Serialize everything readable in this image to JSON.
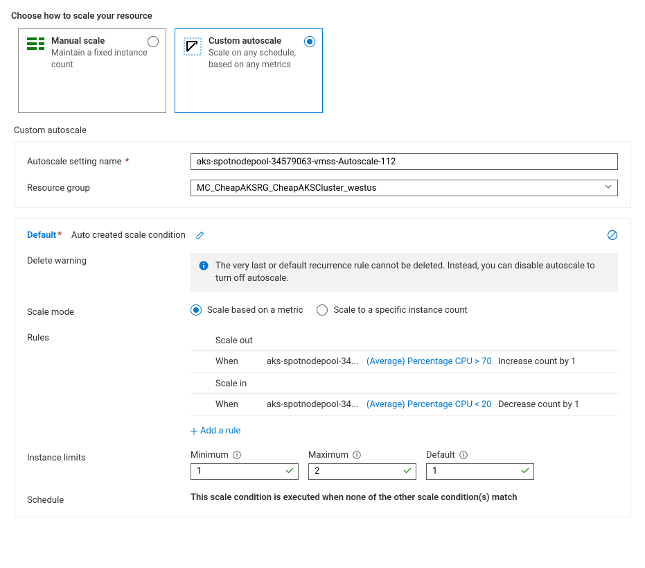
{
  "headings": {
    "choose_how": "Choose how to scale your resource",
    "custom_autoscale": "Custom autoscale"
  },
  "options": {
    "manual": {
      "title": "Manual scale",
      "desc": "Maintain a fixed instance count"
    },
    "custom": {
      "title": "Custom autoscale",
      "desc": "Scale on any schedule, based on any metrics"
    }
  },
  "setting": {
    "name_label": "Autoscale setting name",
    "name_value": "aks-spotnodepool-34579063-vmss-Autoscale-112",
    "rg_label": "Resource group",
    "rg_value": "MC_CheapAKSRG_CheapAKSCluster_westus"
  },
  "condition": {
    "default_label": "Default",
    "name": "Auto created scale condition"
  },
  "delete_warning": {
    "label": "Delete warning",
    "text": "The very last or default recurrence rule cannot be deleted. Instead, you can disable autoscale to turn off autoscale."
  },
  "scale_mode": {
    "label": "Scale mode",
    "metric": "Scale based on a metric",
    "instance": "Scale to a specific instance count"
  },
  "rules": {
    "label": "Rules",
    "scale_out_heading": "Scale out",
    "scale_in_heading": "Scale in",
    "when_label": "When",
    "out": {
      "resource": "aks-spotnodepool-34...",
      "metric": "(Average) Percentage CPU > 70",
      "action": "Increase count by 1"
    },
    "in": {
      "resource": "aks-spotnodepool-34...",
      "metric": "(Average) Percentage CPU < 20",
      "action": "Decrease count by 1"
    },
    "add_rule": "Add a rule"
  },
  "limits": {
    "label": "Instance limits",
    "min_label": "Minimum",
    "min_value": "1",
    "max_label": "Maximum",
    "max_value": "2",
    "default_label": "Default",
    "default_value": "1"
  },
  "schedule": {
    "label": "Schedule",
    "text": "This scale condition is executed when none of the other scale condition(s) match"
  }
}
